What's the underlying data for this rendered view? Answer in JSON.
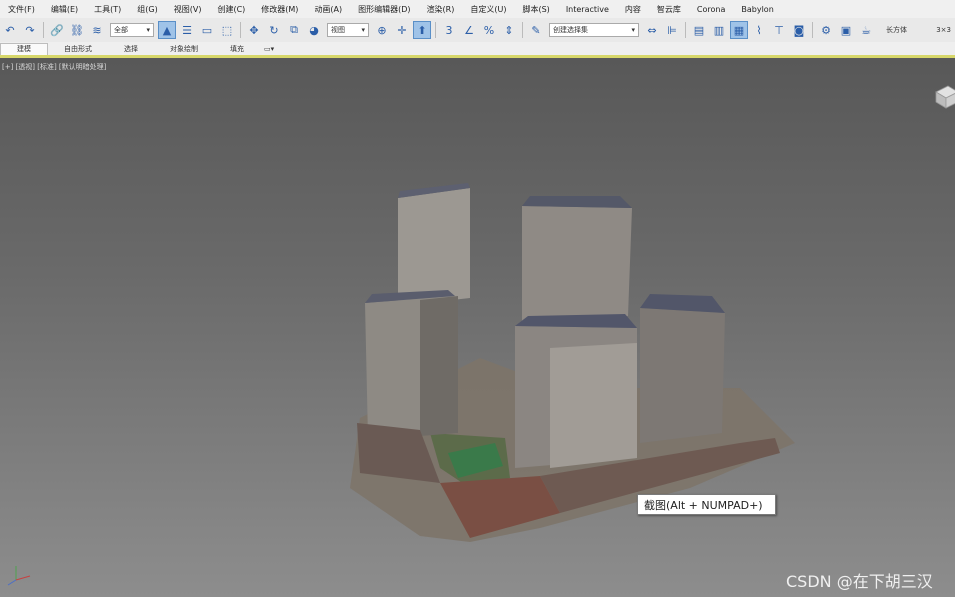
{
  "menu": {
    "items": [
      "文件(F)",
      "编辑(E)",
      "工具(T)",
      "组(G)",
      "视图(V)",
      "创建(C)",
      "修改器(M)",
      "动画(A)",
      "图形编辑器(D)",
      "渲染(R)",
      "自定义(U)",
      "脚本(S)",
      "Interactive",
      "内容",
      "智云库",
      "Corona",
      "Babylon"
    ]
  },
  "toolbar": {
    "selection_filter": "全部",
    "coord_system": "视图",
    "named_selection": "创建选择集",
    "right_label": "长方体",
    "right_value": "3×3"
  },
  "ribbon": {
    "tabs": [
      "建模",
      "自由形式",
      "选择",
      "对象绘制",
      "填充"
    ]
  },
  "viewport": {
    "label": "[+] [透视] [标准] [默认明暗处理]"
  },
  "tooltip": {
    "text": "截图(Alt + NUMPAD+)"
  },
  "watermark": {
    "text": "CSDN @在下胡三汉"
  },
  "colors": {
    "accent": "#d7d76a",
    "toolbar_icon": "#2b5ea8",
    "active_button": "#9fc3e8"
  }
}
